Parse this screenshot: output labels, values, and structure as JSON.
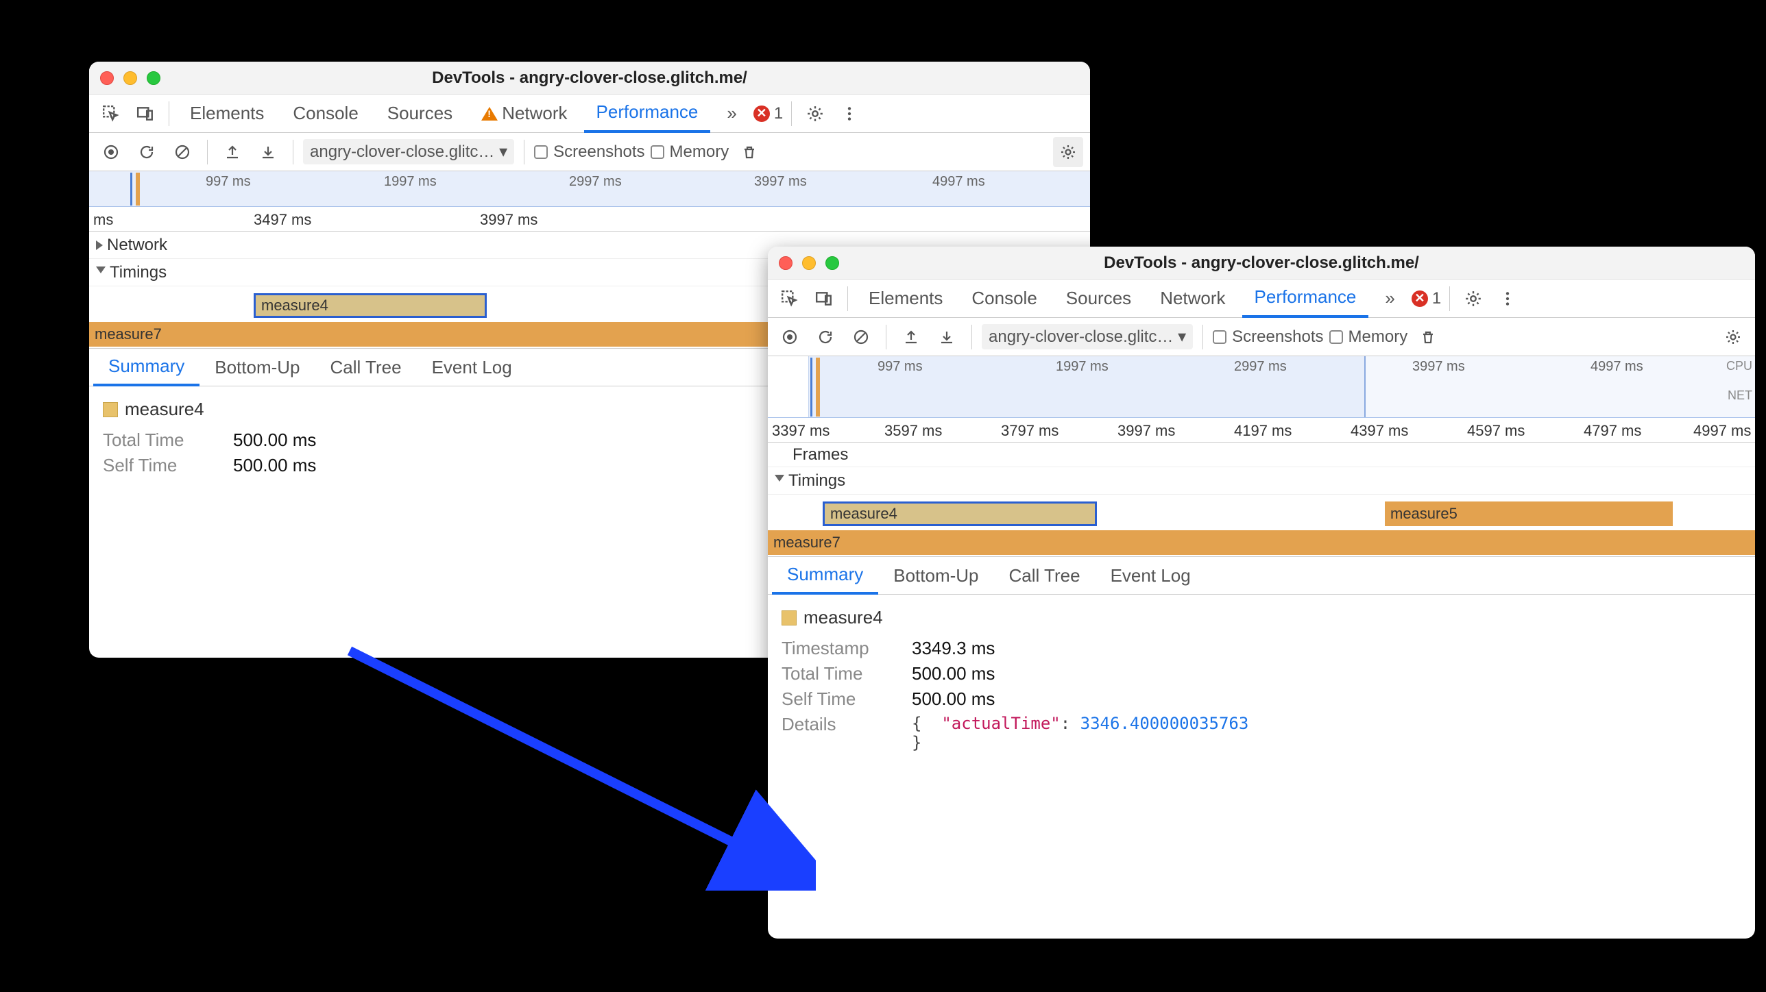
{
  "windowTitle": "DevTools - angry-clover-close.glitch.me/",
  "mainTabs": {
    "elements": "Elements",
    "console": "Console",
    "sources": "Sources",
    "network": "Network",
    "performance": "Performance",
    "more": "»"
  },
  "errorCount": "1",
  "ctrl": {
    "profileSelector": "angry-clover-close.glitc… ▾",
    "screenshots": "Screenshots",
    "memory": "Memory"
  },
  "overviewTicks1": {
    "t1": "997 ms",
    "t2": "1997 ms",
    "t3": "2997 ms",
    "t4": "3997 ms",
    "t5": "4997 ms"
  },
  "ruler1": {
    "a": "ms",
    "b": "3497 ms",
    "c": "3997 ms"
  },
  "tracks": {
    "network": "Network",
    "frames": "Frames",
    "timings": "Timings"
  },
  "measures": {
    "m4": "measure4",
    "m5": "measure5",
    "m7": "measure7"
  },
  "subtabs": {
    "summary": "Summary",
    "bottomUp": "Bottom-Up",
    "callTree": "Call Tree",
    "eventLog": "Event Log"
  },
  "summary1": {
    "name": "measure4",
    "totalTimeLabel": "Total Time",
    "totalTime": "500.00 ms",
    "selfTimeLabel": "Self Time",
    "selfTime": "500.00 ms"
  },
  "ruler2": {
    "a": "3397 ms",
    "b": "3597 ms",
    "c": "3797 ms",
    "d": "3997 ms",
    "e": "4197 ms",
    "f": "4397 ms",
    "g": "4597 ms",
    "h": "4797 ms",
    "i": "4997 ms"
  },
  "summary2": {
    "name": "measure4",
    "timestampLabel": "Timestamp",
    "timestamp": "3349.3 ms",
    "totalTimeLabel": "Total Time",
    "totalTime": "500.00 ms",
    "selfTimeLabel": "Self Time",
    "selfTime": "500.00 ms",
    "detailsLabel": "Details",
    "detailsKey": "\"actualTime\"",
    "detailsVal": "3346.400000035763"
  },
  "ovLabels": {
    "cpu": "CPU",
    "net": "NET"
  }
}
